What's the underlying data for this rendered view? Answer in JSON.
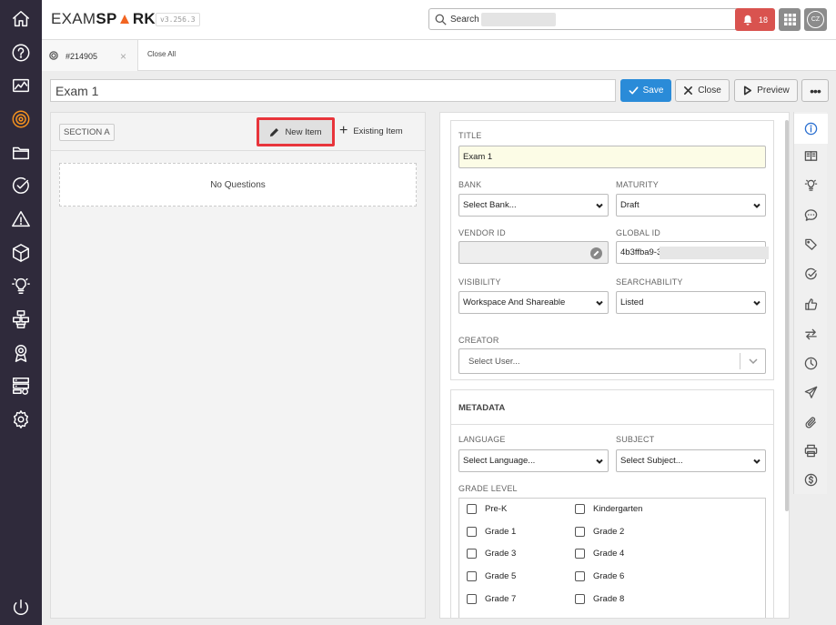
{
  "brand": {
    "logo_left": "EXAM",
    "logo_right_a": "SP",
    "logo_right_b": "RK",
    "version": "v3.256.3"
  },
  "search": {
    "label": "Search"
  },
  "notifications": {
    "count": "18"
  },
  "user": {
    "initials": "CZ"
  },
  "tabs": [
    {
      "label": "#214905"
    }
  ],
  "tabbar": {
    "close_all": "Close All"
  },
  "exam": {
    "title": "Exam 1"
  },
  "toolbar": {
    "save": "Save",
    "close": "Close",
    "preview": "Preview",
    "more": "•••"
  },
  "section": {
    "label": "SECTION A",
    "new_item": "New Item",
    "existing_item": "Existing Item",
    "empty": "No Questions"
  },
  "form": {
    "title_label": "TITLE",
    "title_value": "Exam 1",
    "bank_label": "BANK",
    "bank_value": "Select Bank...",
    "maturity_label": "MATURITY",
    "maturity_value": "Draft",
    "vendor_label": "VENDOR ID",
    "vendor_value": "",
    "global_label": "GLOBAL ID",
    "global_value": "4b3ffba9-3",
    "visibility_label": "VISIBILITY",
    "visibility_value": "Workspace And Shareable",
    "searchability_label": "SEARCHABILITY",
    "searchability_value": "Listed",
    "creator_label": "CREATOR",
    "creator_value": "Select User..."
  },
  "metadata": {
    "title": "METADATA",
    "language_label": "LANGUAGE",
    "language_value": "Select Language...",
    "subject_label": "SUBJECT",
    "subject_value": "Select Subject...",
    "grade_label": "GRADE LEVEL",
    "grades": [
      "Pre-K",
      "Kindergarten",
      "Grade 1",
      "Grade 2",
      "Grade 3",
      "Grade 4",
      "Grade 5",
      "Grade 6",
      "Grade 7",
      "Grade 8"
    ]
  },
  "colors": {
    "accent": "#2a8bd8",
    "sidebar": "#2f2a3b",
    "active_icon": "#f7931e",
    "highlight": "#e8343b",
    "notify": "#d9534f"
  },
  "sidebar_icons": [
    "home-icon",
    "help-icon",
    "analytics-icon",
    "exams-icon",
    "folder-icon",
    "check-icon",
    "warning-icon",
    "cube-icon",
    "lightbulb-icon",
    "workflow-icon",
    "award-icon",
    "server-icon",
    "settings-icon",
    "power-icon"
  ],
  "right_icons": [
    "info-icon",
    "book-icon",
    "lightbulb-icon",
    "comment-icon",
    "tag-icon",
    "check-circle-icon",
    "thumbs-up-icon",
    "swap-icon",
    "clock-icon",
    "send-icon",
    "paperclip-icon",
    "print-icon",
    "dollar-icon"
  ]
}
